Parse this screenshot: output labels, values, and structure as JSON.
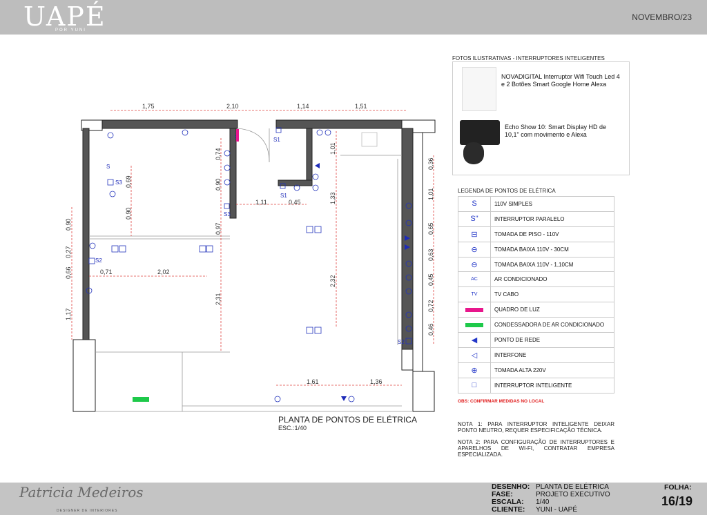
{
  "header": {
    "logo": "UAPÉ",
    "logo_sub": "POR YUNI",
    "date": "NOVEMBRO/23"
  },
  "photos": {
    "title": "FOTOS ILUSTRATIVAS - INTERRUPTORES INTELIGENTES",
    "item1_line1": "NOVADIGITAL Interruptor Wifi Touch Led 4",
    "item1_line2": "e 2  Botões Smart Google Home Alexa",
    "item2_line1": "Echo Show 10: Smart Display HD de",
    "item2_line2": "10,1\" com movimento e Alexa"
  },
  "legend": {
    "title": "LEGENDA DE PONTOS DE ELÉTRICA",
    "items": [
      {
        "symbol": "S",
        "label": "110V SIMPLES"
      },
      {
        "symbol": "S\"",
        "label": "INTERRUPTOR PARALELO"
      },
      {
        "symbol": "⊟",
        "label": "TOMADA DE PISO - 110V"
      },
      {
        "symbol": "⊖",
        "label": "TOMADA BAIXA 110V - 30CM"
      },
      {
        "symbol": "⊖",
        "label": "TOMADA BAIXA 110V - 1,10CM"
      },
      {
        "symbol": "AC",
        "label": "AR CONDICIONADO"
      },
      {
        "symbol": "TV",
        "label": "TV CABO"
      },
      {
        "symbol": "",
        "label": "QUADRO DE LUZ",
        "color": "#e8178c"
      },
      {
        "symbol": "",
        "label": "CONDESSADORA DE AR CONDICIONADO",
        "color": "#1ec94a"
      },
      {
        "symbol": "◀",
        "label": "PONTO DE REDE"
      },
      {
        "symbol": "◁",
        "label": "INTERFONE"
      },
      {
        "symbol": "⊕",
        "label": "TOMADA  ALTA 220V"
      },
      {
        "symbol": "□",
        "label": "INTERRUPTOR INTELIGENTE"
      }
    ],
    "obs": "OBS: CONFIRMAR MEDIDAS NO LOCAL"
  },
  "notes": {
    "nota1": "NOTA 1: PARA INTERRUPTOR INTELIGENTE DEIXAR PONTO NEUTRO, REQUER ESPECIFICAÇÃO TÉCNICA.",
    "nota2": "NOTA 2: PARA CONFIGURAÇÃO DE INTERRUPTORES E APARELHOS DE WI-FI, CONTRATAR EMPRESA ESPECIALIZADA."
  },
  "plan": {
    "title": "PLANTA DE PONTOS DE ELÉTRICA",
    "scale": "ESC.:1/40",
    "dimensions": {
      "top": [
        "1,75",
        "2,10",
        "1,14",
        "1,51"
      ],
      "left": [
        "0,90",
        "0,27",
        "0,66",
        "1,17"
      ],
      "right": [
        "0,36",
        "1,01",
        "0,65",
        "0,63",
        "0,45",
        "0,72",
        "0,46"
      ],
      "room": [
        "0,74",
        "0,90",
        "0,97",
        "0,69",
        "0,90",
        "0,71",
        "2,02",
        "2,31",
        "1,11",
        "0,45",
        "1,01",
        "1,33",
        "2,32",
        "1,61",
        "1,36"
      ]
    },
    "switch_labels": [
      "S",
      "S1",
      "S1",
      "S",
      "S3",
      "S3",
      "S2",
      "S2"
    ]
  },
  "footer": {
    "signature": "Patricia Medeiros",
    "signature_sub": "DESIGNER DE INTERIORES",
    "labels": {
      "desenho": "DESENHO:",
      "fase": "FASE:",
      "escala": "ESCALA:",
      "cliente": "CLIENTE:"
    },
    "values": {
      "desenho": "PLANTA DE ELÉTRICA",
      "fase": "PROJETO EXECUTIVO",
      "escala": "1/40",
      "cliente": "YUNI - UAPÉ"
    },
    "folha_label": "FOLHA:",
    "folha_value": "16/19"
  }
}
